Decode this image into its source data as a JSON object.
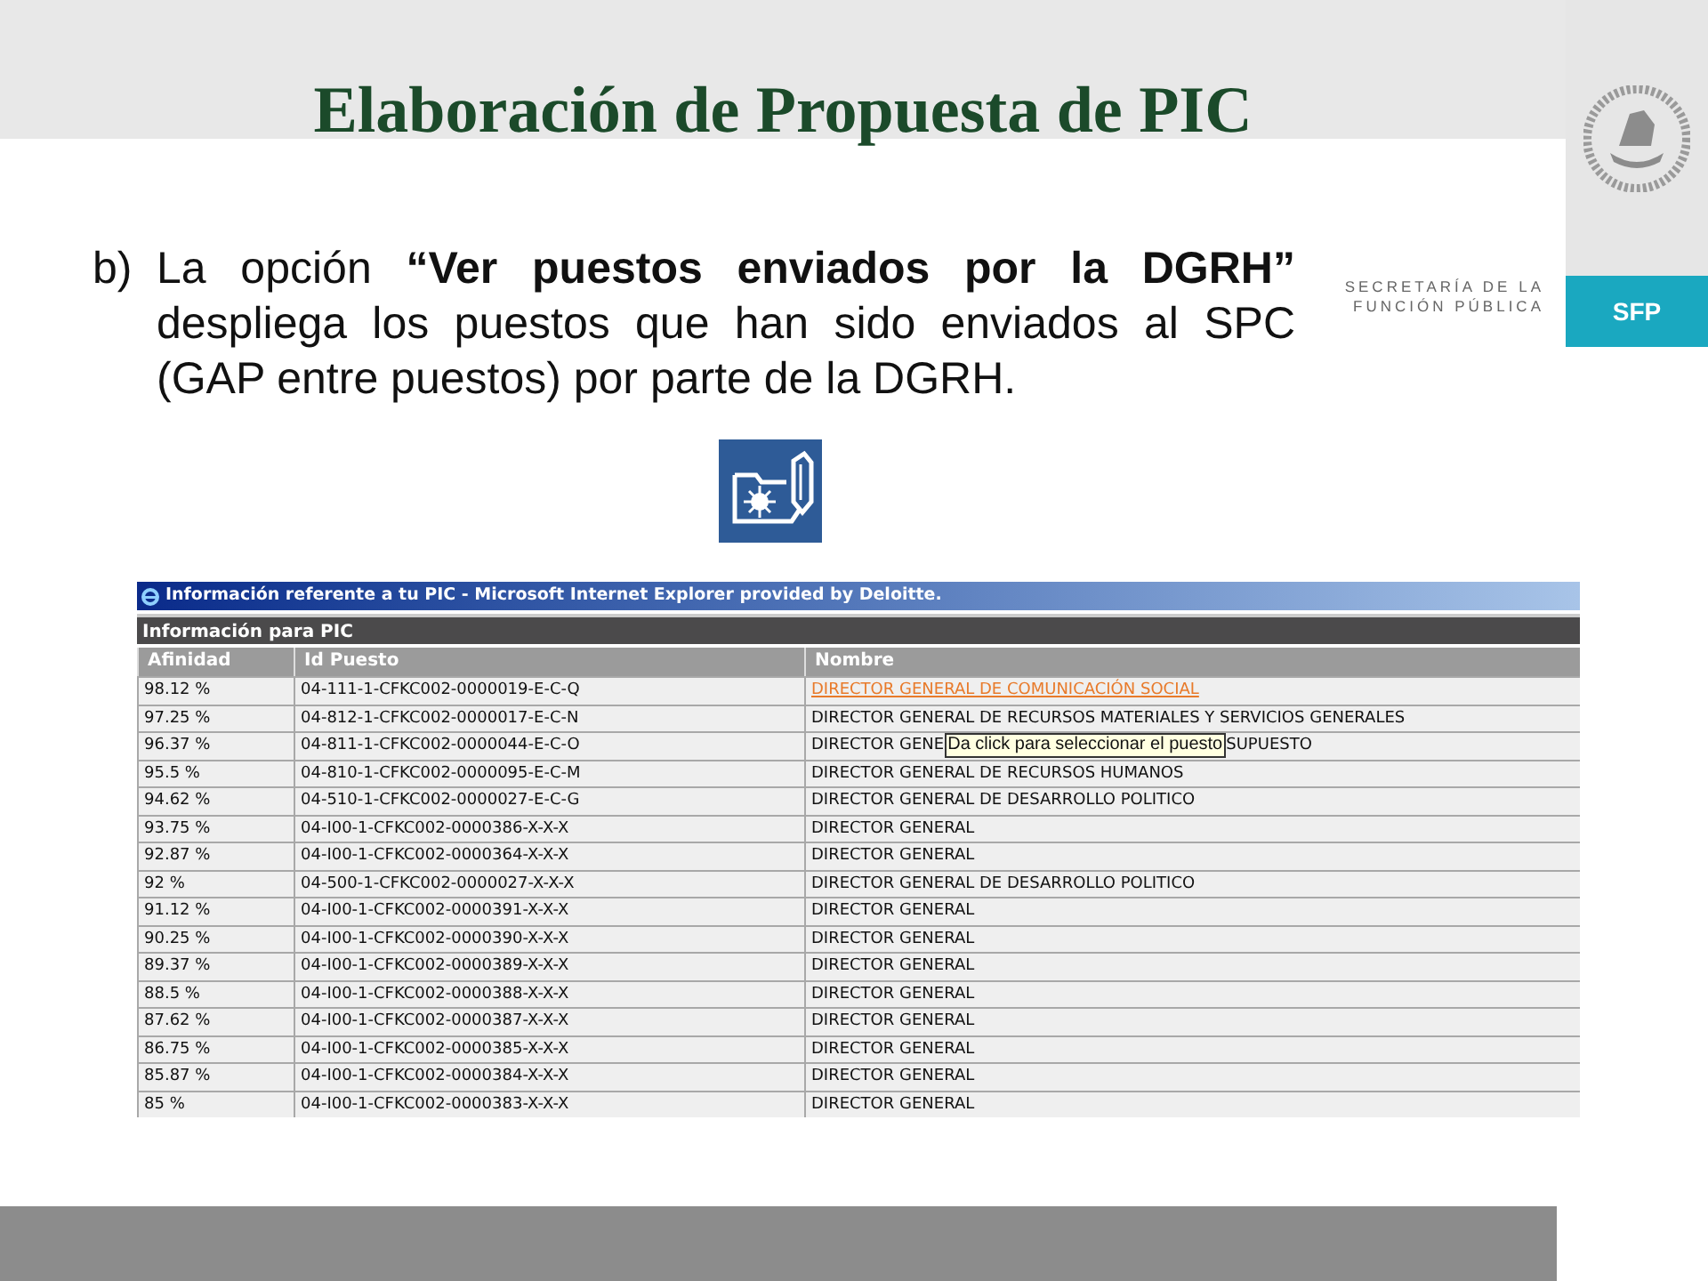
{
  "slide": {
    "title": "Elaboración de Propuesta de PIC",
    "marker": "b)",
    "paragraph": "La opción **“Ver puestos enviados por la DGRH”** despliega los puestos que han sido enviados al SPC (GAP entre puestos) por parte de la DGRH.",
    "logo_lines": [
      "SECRETARÍA DE LA",
      "FUNCIÓN PÚBLICA"
    ],
    "badge": "SFP"
  },
  "browser": {
    "title": "Información referente a tu PIC - Microsoft Internet Explorer provided by Deloitte.",
    "panel_title": "Información para PIC",
    "columns": [
      "Afinidad",
      "Id Puesto",
      "Nombre"
    ],
    "rows": [
      {
        "afinidad": "98.12 %",
        "id_puesto": "04-111-1-CFKC002-0000019-E-C-Q",
        "nombre": "DIRECTOR GENERAL DE COMUNICACIÓN SOCIAL",
        "hovered": true
      },
      {
        "afinidad": "97.25 %",
        "id_puesto": "04-812-1-CFKC002-0000017-E-C-N",
        "nombre": "DIRECTOR GENERAL DE RECURSOS MATERIALES Y SERVICIOS GENERALES",
        "hovered": false
      },
      {
        "afinidad": "96.37 %",
        "id_puesto": "04-811-1-CFKC002-0000044-E-C-O",
        "nombre": "DIRECTOR GENE",
        "nombre_rest": "SUPUESTO",
        "tooltip": "Da click para seleccionar el puesto",
        "hovered": false
      },
      {
        "afinidad": "95.5 %",
        "id_puesto": "04-810-1-CFKC002-0000095-E-C-M",
        "nombre": "DIRECTOR GENERAL DE RECURSOS HUMANOS",
        "hovered": false
      },
      {
        "afinidad": "94.62 %",
        "id_puesto": "04-510-1-CFKC002-0000027-E-C-G",
        "nombre": "DIRECTOR GENERAL DE DESARROLLO POLITICO",
        "hovered": false
      },
      {
        "afinidad": "93.75 %",
        "id_puesto": "04-I00-1-CFKC002-0000386-X-X-X",
        "nombre": "DIRECTOR GENERAL",
        "hovered": false
      },
      {
        "afinidad": "92.87 %",
        "id_puesto": "04-I00-1-CFKC002-0000364-X-X-X",
        "nombre": "DIRECTOR GENERAL",
        "hovered": false
      },
      {
        "afinidad": "92 %",
        "id_puesto": "04-500-1-CFKC002-0000027-X-X-X",
        "nombre": "DIRECTOR GENERAL DE DESARROLLO POLITICO",
        "hovered": false
      },
      {
        "afinidad": "91.12 %",
        "id_puesto": "04-I00-1-CFKC002-0000391-X-X-X",
        "nombre": "DIRECTOR GENERAL",
        "hovered": false
      },
      {
        "afinidad": "90.25 %",
        "id_puesto": "04-I00-1-CFKC002-0000390-X-X-X",
        "nombre": "DIRECTOR GENERAL",
        "hovered": false
      },
      {
        "afinidad": "89.37 %",
        "id_puesto": "04-I00-1-CFKC002-0000389-X-X-X",
        "nombre": "DIRECTOR GENERAL",
        "hovered": false
      },
      {
        "afinidad": "88.5 %",
        "id_puesto": "04-I00-1-CFKC002-0000388-X-X-X",
        "nombre": "DIRECTOR GENERAL",
        "hovered": false
      },
      {
        "afinidad": "87.62 %",
        "id_puesto": "04-I00-1-CFKC002-0000387-X-X-X",
        "nombre": "DIRECTOR GENERAL",
        "hovered": false
      },
      {
        "afinidad": "86.75 %",
        "id_puesto": "04-I00-1-CFKC002-0000385-X-X-X",
        "nombre": "DIRECTOR GENERAL",
        "hovered": false
      },
      {
        "afinidad": "85.87 %",
        "id_puesto": "04-I00-1-CFKC002-0000384-X-X-X",
        "nombre": "DIRECTOR GENERAL",
        "hovered": false
      },
      {
        "afinidad": "85 %",
        "id_puesto": "04-I00-1-CFKC002-0000383-X-X-X",
        "nombre": "DIRECTOR GENERAL",
        "hovered": false
      }
    ]
  }
}
